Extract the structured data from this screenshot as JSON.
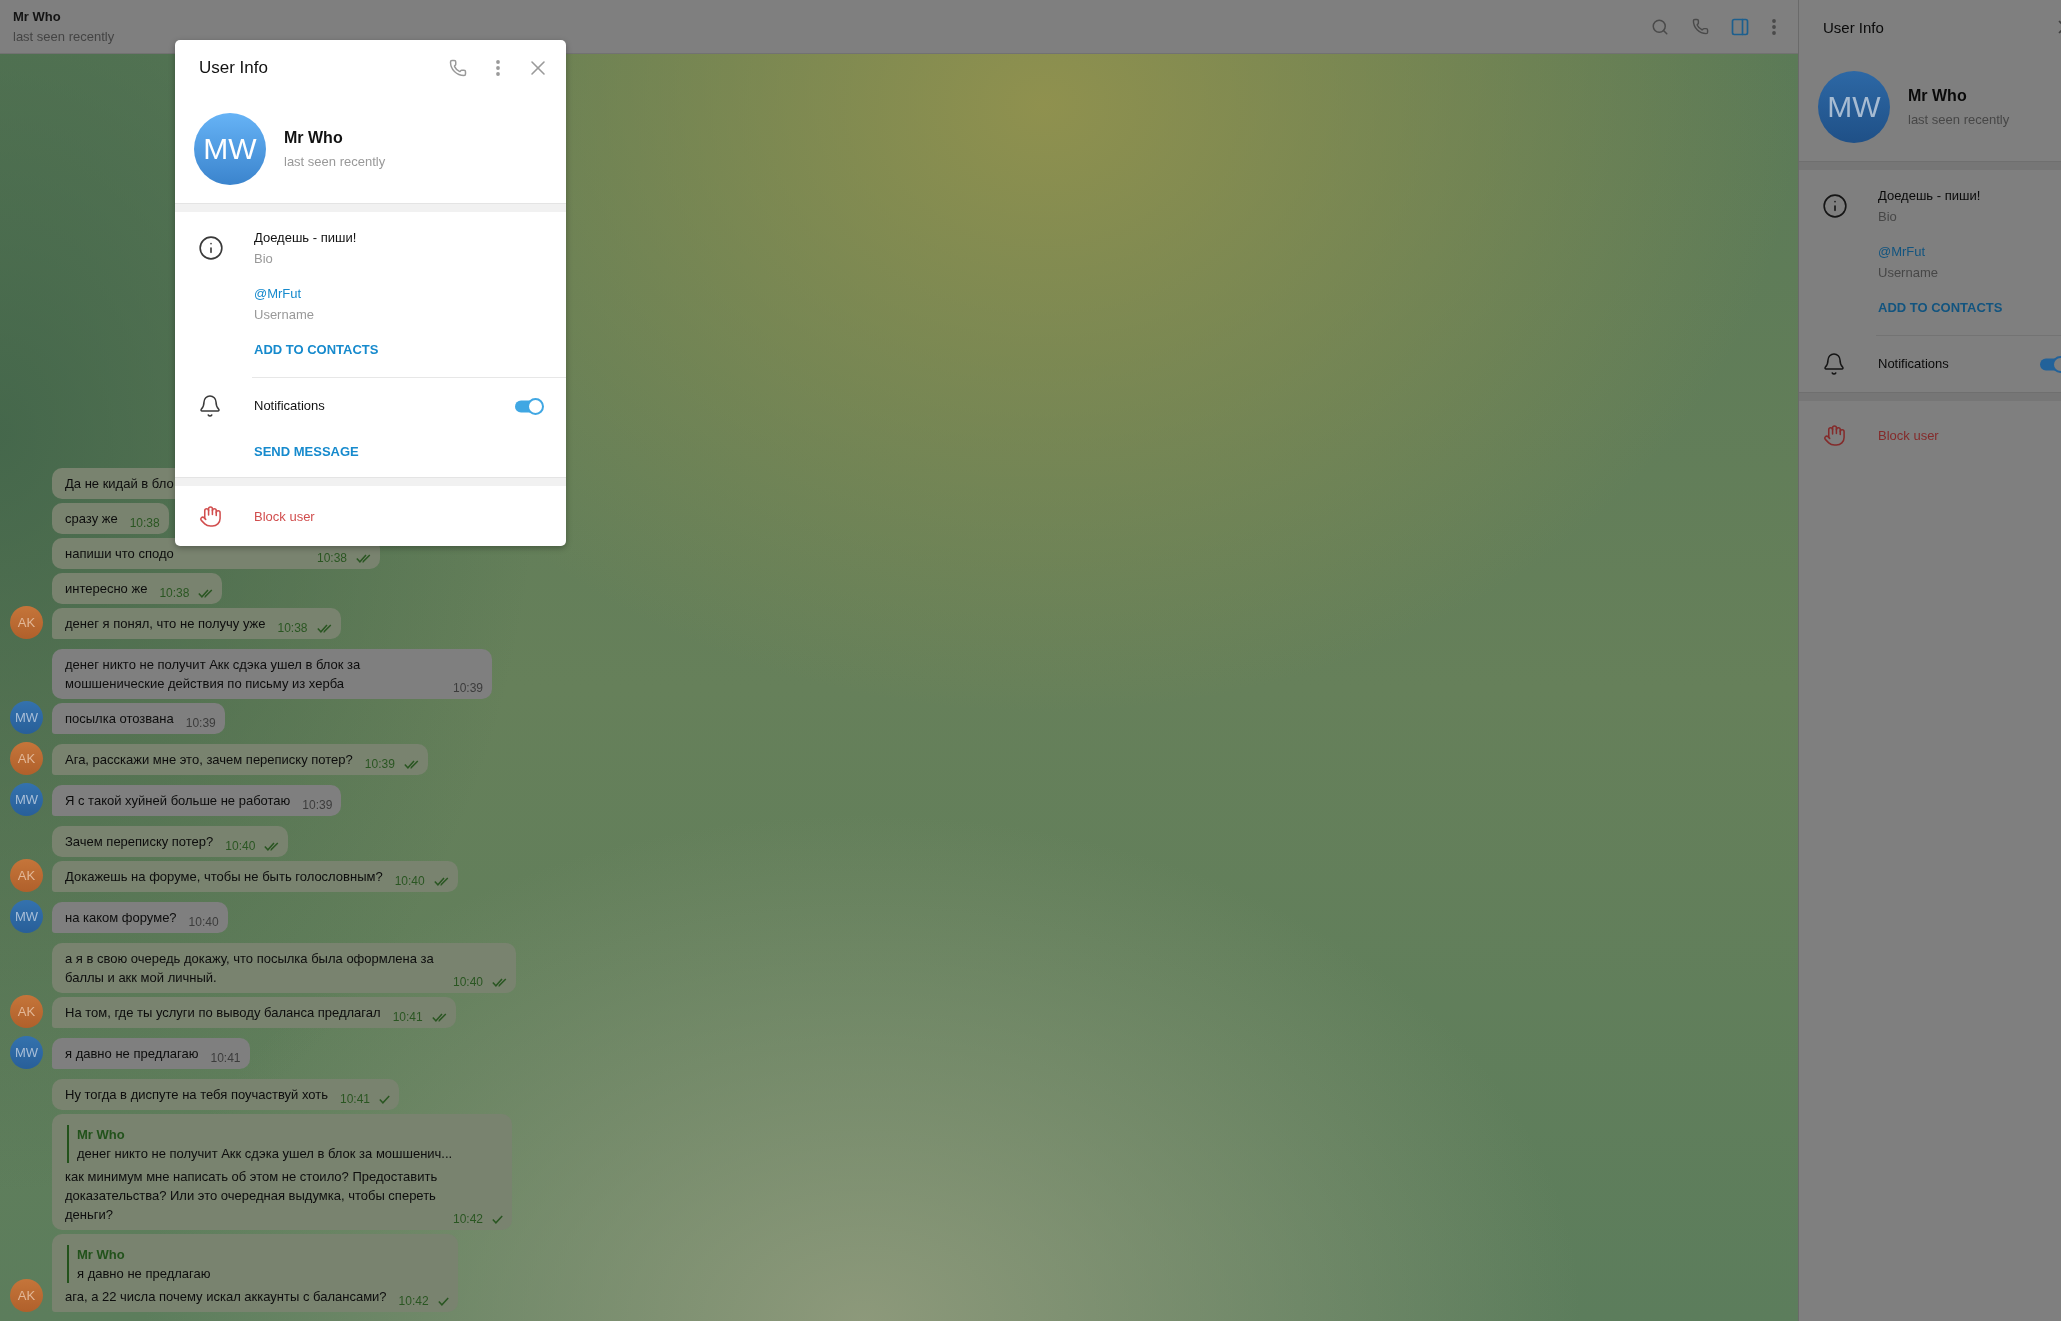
{
  "top_bar": {
    "title": "Mr Who",
    "status": "last seen recently",
    "buttons": [
      {
        "kind": "search",
        "on": false
      },
      {
        "kind": "call",
        "on": false
      },
      {
        "kind": "sidebar",
        "on": true
      },
      {
        "kind": "more",
        "on": false
      }
    ]
  },
  "messages": [
    {
      "kind": "outgoing",
      "text": "Да не кидай в бло",
      "runs_under_dialog": true
    },
    {
      "kind": "outgoing",
      "text": "сразу же",
      "time": "10:38"
    },
    {
      "kind": "outgoing",
      "text": "напиши что сподо",
      "runs_under_dialog": true,
      "time": "10:38",
      "read": true
    },
    {
      "kind": "outgoing",
      "text": "интересно же",
      "time": "10:38",
      "read": true
    },
    {
      "kind": "outgoing",
      "text": "денег я понял, что не получу уже",
      "time": "10:38",
      "read": true,
      "avatar": "AK"
    },
    {
      "kind": "incoming",
      "text": "денег никто не получит Акк сдэка ушел в блок за мошшенические действия по письму из херба",
      "time": "10:39"
    },
    {
      "kind": "incoming",
      "text": "посылка отозвана",
      "time": "10:39",
      "avatar": "MW"
    },
    {
      "kind": "outgoing",
      "text": "Ага, расскажи мне это, зачем переписку потер?",
      "time": "10:39",
      "read": true,
      "avatar": "AK"
    },
    {
      "kind": "incoming",
      "text": "Я с такой хуйней больше не работаю",
      "time": "10:39",
      "avatar": "MW"
    },
    {
      "kind": "outgoing",
      "text": "Зачем переписку потер?",
      "time": "10:40",
      "read": true
    },
    {
      "kind": "outgoing",
      "text": "Докажешь на форуме, чтобы не быть голословным?",
      "time": "10:40",
      "read": true,
      "avatar": "AK"
    },
    {
      "kind": "incoming",
      "text": "на каком форуме?",
      "time": "10:40",
      "avatar": "MW"
    },
    {
      "kind": "outgoing",
      "text": "а я в свою очередь докажу, что посылка была оформлена за баллы и акк мой личный.",
      "time": "10:40",
      "read": true
    },
    {
      "kind": "outgoing",
      "text": "На том, где ты услуги по выводу баланса предлагал",
      "time": "10:41",
      "read": true,
      "avatar": "AK"
    },
    {
      "kind": "incoming",
      "text": "я давно не предлагаю",
      "time": "10:41",
      "avatar": "MW"
    },
    {
      "kind": "outgoing",
      "text": "Ну тогда в диспуте на тебя поучаствуй хоть",
      "time": "10:41",
      "read": false
    },
    {
      "kind": "outgoing",
      "reply": {
        "author": "Mr Who",
        "text": "денег никто не получит Акк сдэка ушел в блок за мошшенич..."
      },
      "text": "как минимум мне написать об этом не стоило? Предоставить доказательства? Или это очередная выдумка, чтобы спереть деньги?",
      "time": "10:42",
      "read": false
    },
    {
      "kind": "outgoing",
      "reply": {
        "author": "Mr Who",
        "text": "я давно не предлагаю"
      },
      "text": "ага, а 22 числа почему искал аккаунты с балансами?",
      "time": "10:42",
      "read": false,
      "avatar": "AK"
    }
  ],
  "dialog": {
    "title": "User Info",
    "avatar": "MW",
    "name": "Mr Who",
    "status": "last seen recently",
    "bio": "Доедешь - пиши!",
    "bio_label": "Bio",
    "username": "@MrFut",
    "username_label": "Username",
    "add_contact": "ADD TO CONTACTS",
    "notifications": {
      "label": "Notifications",
      "on": true
    },
    "send_message": "SEND MESSAGE",
    "block": "Block user"
  },
  "side_panel": {
    "title": "User Info",
    "avatar": "MW",
    "name": "Mr Who",
    "status": "last seen recently",
    "bio": "Доедешь - пиши!",
    "bio_label": "Bio",
    "username": "@MrFut",
    "username_label": "Username",
    "add_contact": "ADD TO CONTACTS",
    "notifications": {
      "label": "Notifications",
      "on": true
    },
    "block": "Block user"
  }
}
